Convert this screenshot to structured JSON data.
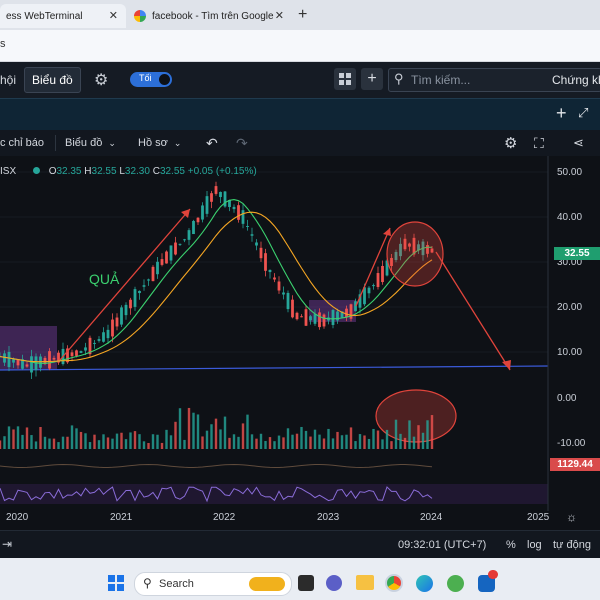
{
  "browser": {
    "tabs": [
      {
        "title": "ess WebTerminal",
        "active": false
      },
      {
        "title": "facebook - Tìm trên Google",
        "active": false
      }
    ],
    "new_tab": "+",
    "address_text": "s"
  },
  "app": {
    "nav_left": "hội",
    "nav_active": "Biểu đồ",
    "theme_toggle_label": "Tối",
    "search_placeholder": "Tìm kiếm...",
    "right_label": "Chứng kh"
  },
  "toolbar": {
    "indicators": "c chỉ báo",
    "chart_menu": "Biểu đồ",
    "profile_menu": "Hồ sơ"
  },
  "legend": {
    "symbol": "ISX",
    "open_label": "O",
    "open": "32.35",
    "high_label": "H",
    "high": "32.55",
    "low_label": "L",
    "low": "32.30",
    "close_label": "C",
    "close": "32.55",
    "change": "+0.05 (+0.15%)"
  },
  "annotation": {
    "text": "QUẢ"
  },
  "price_axis": {
    "labels": [
      "50.00",
      "40.00",
      "30.00",
      "20.00",
      "10.00"
    ],
    "current_price": "32.55",
    "current_price_color": "#1f9e6f"
  },
  "volume_axis": {
    "labels": [
      "0.00",
      "-10.00"
    ],
    "indicator_value": "1129.44",
    "indicator_color": "#d94b4b"
  },
  "time_axis": {
    "labels": [
      "2020",
      "2021",
      "2022",
      "2023",
      "2024",
      "2025"
    ]
  },
  "status": {
    "clock": "09:32:01 (UTC+7)",
    "percent": "%",
    "log": "log",
    "auto": "tự động"
  },
  "taskbar": {
    "search_label": "Search"
  },
  "colors": {
    "candle_up": "#26a69a",
    "candle_down": "#ef5350",
    "ma_green": "#3bd16f",
    "ma_orange": "#f5a623",
    "arrow": "#e0443b",
    "support_line": "#3b5bdb",
    "box_purple": "#7b3fa0"
  },
  "chart_data": {
    "type": "line",
    "title": "",
    "x": [
      "2020-01",
      "2020-04",
      "2020-07",
      "2020-10",
      "2021-01",
      "2021-04",
      "2021-07",
      "2021-10",
      "2022-01",
      "2022-04",
      "2022-07",
      "2022-10",
      "2023-01",
      "2023-04",
      "2023-07",
      "2023-10",
      "2024-01"
    ],
    "series": [
      {
        "values": [
          9,
          7,
          8.5,
          10,
          14,
          22,
          30,
          36,
          46,
          40,
          28,
          18,
          17,
          19,
          26,
          34,
          32.55
        ]
      }
    ],
    "ylim": [
      0,
      55
    ],
    "xlabel": "",
    "ylabel": ""
  }
}
